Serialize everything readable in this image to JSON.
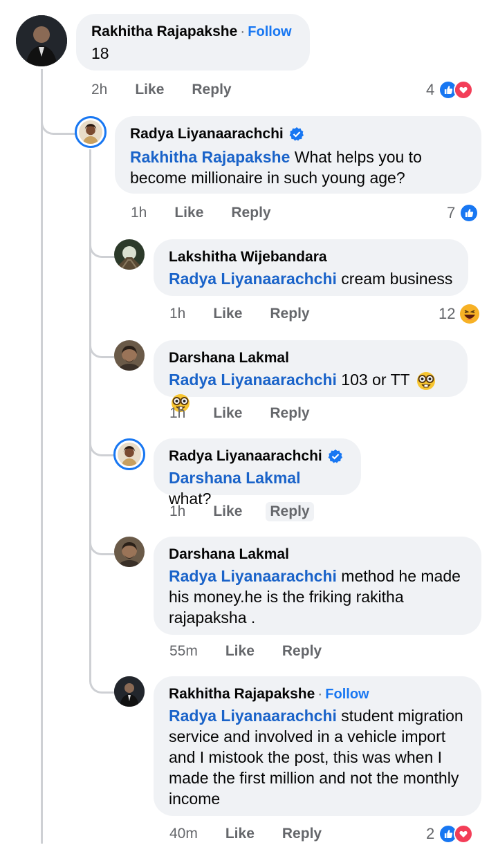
{
  "colors": {
    "accent": "#1877f2",
    "bubble": "#f0f2f5",
    "meta": "#65676b",
    "mention": "#1a63c9",
    "love": "#f33e58"
  },
  "comments": [
    {
      "name": "Rakhitha Rajapakshe",
      "dot": "·",
      "follow": "Follow",
      "body": "18",
      "time": "2h",
      "like": "Like",
      "reply": "Reply",
      "reactions": {
        "count": "4",
        "icons": [
          "like-icon",
          "love-icon"
        ]
      }
    },
    {
      "name": "Radya Liyanaarachchi",
      "verified": true,
      "mention": "Rakhitha Rajapakshe",
      "body": " What helps you to become millionaire in such young age?",
      "time": "1h",
      "like": "Like",
      "reply": "Reply",
      "reactions": {
        "count": "7",
        "icons": [
          "like-icon"
        ]
      }
    },
    {
      "name": "Lakshitha Wijebandara",
      "mention": "Radya Liyanaarachchi",
      "body": " cream business",
      "time": "1h",
      "like": "Like",
      "reply": "Reply",
      "reactions": {
        "count": "12",
        "icons": [
          "haha-icon"
        ]
      }
    },
    {
      "name": "Darshana Lakmal",
      "mention": "Radya Liyanaarachchi",
      "body": " 103 or TT",
      "emojis": [
        "nerd-glasses-emoji",
        "nerd-glasses-emoji"
      ],
      "time": "1h",
      "like": "Like",
      "reply": "Reply"
    },
    {
      "name": "Radya Liyanaarachchi",
      "verified": true,
      "mention": "Darshana Lakmal",
      "body": " what?",
      "time": "1h",
      "like": "Like",
      "reply": "Reply"
    },
    {
      "name": "Darshana Lakmal",
      "mention": "Radya Liyanaarachchi",
      "body": " method he made his money.he is the friking rakitha rajapaksha .",
      "time": "55m",
      "like": "Like",
      "reply": "Reply"
    },
    {
      "name": "Rakhitha Rajapakshe",
      "dot": "·",
      "follow": "Follow",
      "mention": "Radya Liyanaarachchi",
      "body": " student migration service and involved in a vehicle import and I mistook the post, this was when I made the first million and not the monthly income",
      "time": "40m",
      "like": "Like",
      "reply": "Reply",
      "reactions": {
        "count": "2",
        "icons": [
          "like-icon",
          "love-icon"
        ]
      }
    }
  ]
}
